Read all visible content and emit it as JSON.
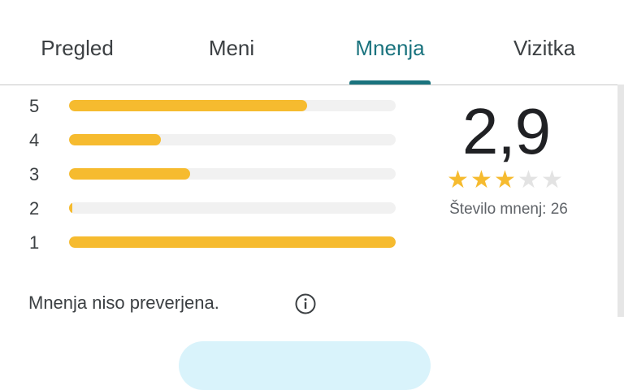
{
  "tabs": [
    {
      "label": "Pregled",
      "active": false
    },
    {
      "label": "Meni",
      "active": false
    },
    {
      "label": "Mnenja",
      "active": true
    },
    {
      "label": "Vizitka",
      "active": false
    }
  ],
  "rating": {
    "score": "2,9",
    "stars_filled": 3,
    "stars_total": 5,
    "count_text": "Število mnenj: 26"
  },
  "distribution": [
    {
      "label": "5",
      "fraction": 0.73
    },
    {
      "label": "4",
      "fraction": 0.28
    },
    {
      "label": "3",
      "fraction": 0.37
    },
    {
      "label": "2",
      "fraction": 0.01
    },
    {
      "label": "1",
      "fraction": 1.0
    }
  ],
  "note": "Mnenja niso preverjena.",
  "colors": {
    "accent": "#1a737e",
    "bar_fill": "#f6bb2f",
    "bar_track": "#f1f1f1",
    "star_off": "#e3e3e3"
  },
  "icons": {
    "info": "info-icon"
  }
}
